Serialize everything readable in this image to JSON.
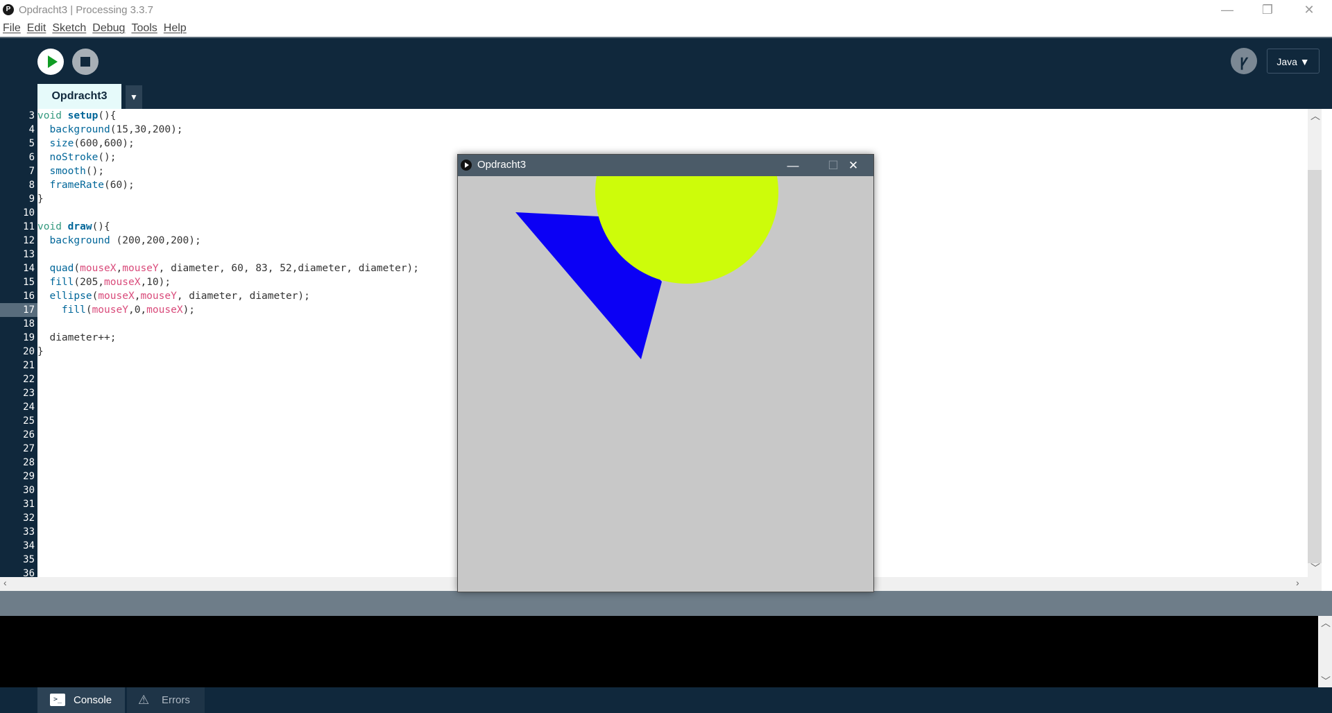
{
  "window": {
    "title": "Opdracht3 | Processing 3.3.7",
    "app_icon_glyph": "P",
    "minimize_glyph": "—",
    "restore_glyph": "❐",
    "close_glyph": "✕"
  },
  "menu": [
    "File",
    "Edit",
    "Sketch",
    "Debug",
    "Tools",
    "Help"
  ],
  "toolbar": {
    "debug_glyph": "ꝩ",
    "mode_label": "Java ▼"
  },
  "tab": {
    "label": "Opdracht3",
    "menu_glyph": "▼"
  },
  "editor": {
    "current_line": 17,
    "line_numbers": [
      "3",
      "4",
      "5",
      "6",
      "7",
      "8",
      "9",
      "10",
      "11",
      "12",
      "13",
      "14",
      "15",
      "16",
      "17",
      "18",
      "19",
      "20",
      "21",
      "22",
      "23",
      "24",
      "25",
      "26",
      "27",
      "28",
      "29",
      "30",
      "31",
      "32",
      "33",
      "34",
      "35",
      "36"
    ],
    "code_lines": [
      "void setup(){",
      "  background(15,30,200);",
      "  size(600,600);",
      "  noStroke();",
      "  smooth();",
      "  frameRate(60);",
      "}",
      "",
      "void draw(){",
      "  background (200,200,200);",
      "",
      "  quad(mouseX,mouseY, diameter, 60, 83, 52,diameter, diameter);",
      "  fill(205,mouseX,10);",
      "  ellipse(mouseX,mouseY, diameter, diameter);",
      "    fill(mouseY,0,mouseX);",
      "",
      "  diameter++;",
      "}"
    ]
  },
  "sketch_window": {
    "title": "Opdracht3",
    "minimize_glyph": "—",
    "maximize_glyph": "☐",
    "close_glyph": "✕",
    "background_color": "#c8c8c8",
    "quad_color": "#0b00f5",
    "ellipse_color": "#cdfc0a"
  },
  "footer": {
    "console_label": "Console",
    "errors_label": "Errors",
    "console_icon": ">_",
    "errors_icon": "⚠"
  },
  "colors": {
    "toolbar_bg": "#10283c",
    "run_green": "#109c24",
    "current_line_bg": "#e6fafa"
  }
}
